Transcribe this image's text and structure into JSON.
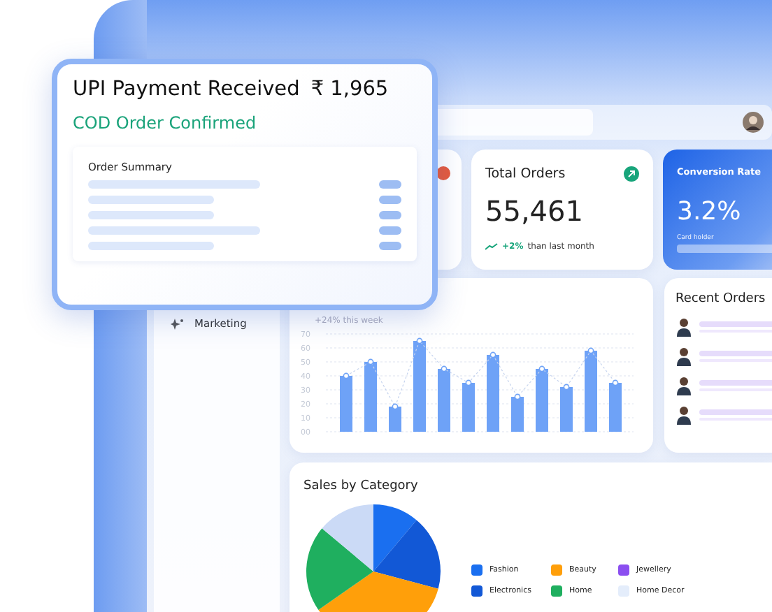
{
  "notification": {
    "title": "UPI Payment Received",
    "amount": "₹ 1,965",
    "status": "COD Order Confirmed",
    "summary_title": "Order Summary"
  },
  "sidebar": {
    "items": [
      {
        "label": "Marketing"
      }
    ]
  },
  "stats": [
    {
      "kind": "metric",
      "title": "Total Orders",
      "value": "55,461",
      "change": "+2%",
      "note": "than last month"
    },
    {
      "kind": "highlight",
      "title": "Conversion Rate",
      "value": "3.2%",
      "note": "Card holder"
    }
  ],
  "weekly": {
    "subtitle": "+24% this week",
    "chart_data": {
      "type": "bar",
      "grid": true,
      "values": [
        40,
        50,
        18,
        65,
        45,
        35,
        55,
        25,
        45,
        32,
        58,
        35
      ],
      "ylim": [
        0,
        70
      ],
      "yticks": [
        {
          "value": 0,
          "label": "00"
        },
        10,
        20,
        30,
        40,
        50,
        60,
        70
      ]
    }
  },
  "recent_orders": {
    "title": "Recent Orders"
  },
  "sales": {
    "title": "Sales by Category",
    "legend": [
      {
        "label": "Fashion",
        "color": "#1a6ff0"
      },
      {
        "label": "Beauty",
        "color": "#ff9f0a"
      },
      {
        "label": "Jewellery",
        "color": "#8b4ff0"
      },
      {
        "label": "Electronics",
        "color": "#1258d6"
      },
      {
        "label": "Home",
        "color": "#1faf5f"
      },
      {
        "label": "Home Decor",
        "color": "#e4edfb"
      }
    ]
  }
}
